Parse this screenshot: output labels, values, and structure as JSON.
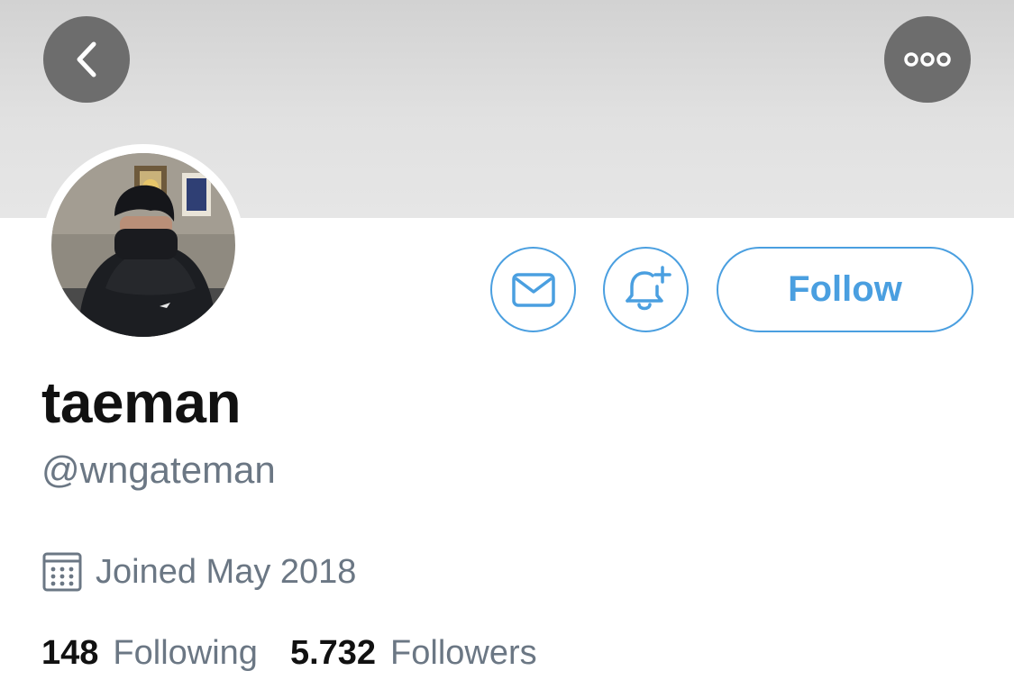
{
  "header": {
    "back_icon": "chevron-left-icon",
    "more_icon": "ellipsis-icon"
  },
  "profile": {
    "display_name": "taeman",
    "handle": "@wngateman",
    "joined": "Joined May 2018",
    "joined_icon": "calendar-icon"
  },
  "actions": {
    "message_icon": "envelope-icon",
    "notify_icon": "bell-plus-icon",
    "follow_label": "Follow"
  },
  "stats": {
    "following_count": "148",
    "following_label": "Following",
    "followers_count": "5.732",
    "followers_label": "Followers"
  },
  "colors": {
    "accent": "#4a9fe0",
    "banner": "#e0e0e0",
    "overlay_button": "#6d6d6d",
    "muted_text": "#6b7784",
    "primary_text": "#111111"
  }
}
